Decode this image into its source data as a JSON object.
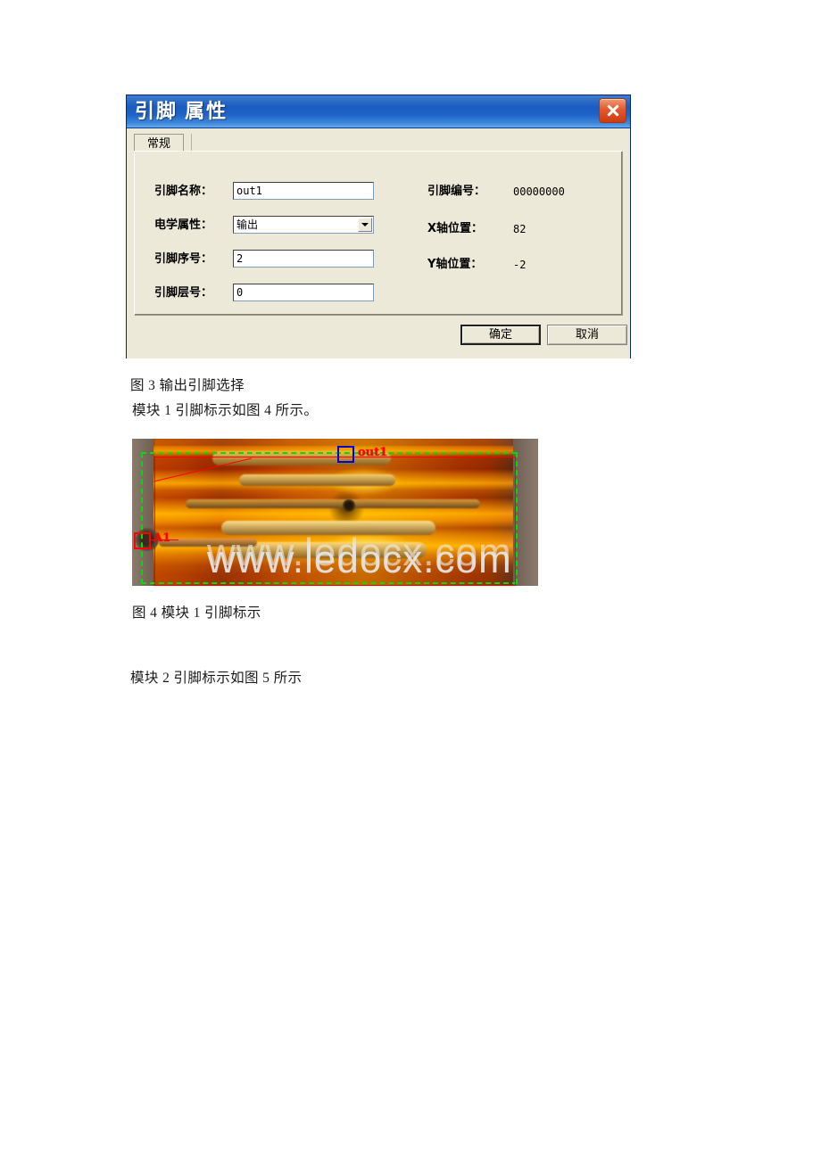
{
  "dialog": {
    "title": "引脚 属性",
    "close_icon": "close-icon",
    "tab": {
      "label": "常规"
    },
    "fields": {
      "pin_name": {
        "label": "引脚名称：",
        "value": "out1"
      },
      "electrical": {
        "label": "电学属性：",
        "value": "输出",
        "arrow_icon": "chevron-down-icon"
      },
      "pin_index": {
        "label": "引脚序号：",
        "value": "2"
      },
      "pin_layer": {
        "label": "引脚层号：",
        "value": "0"
      }
    },
    "readonly": {
      "pin_number": {
        "label": "引脚编号：",
        "value": "00000000"
      },
      "x_position": {
        "label": "X轴位置：",
        "value": "82"
      },
      "y_position": {
        "label": "Y轴位置：",
        "value": "-2"
      }
    },
    "buttons": {
      "ok": "确定",
      "cancel": "取消"
    },
    "colors": {
      "titlebar": "#1a5cc0",
      "face": "#ece9d8",
      "close": "#cf3a10"
    }
  },
  "document": {
    "fig3_caption": "图 3 输出引脚选择",
    "para1": "模块 1 引脚标示如图 4 所示。",
    "fig4_caption": "图 4 模块 1 引脚标示",
    "para2": "模块 2 引脚标示如图 5 所示"
  },
  "figure": {
    "annotations": {
      "out1_label": "out1",
      "a1_label": "A1"
    },
    "watermark": "www.ledocx.com",
    "colors": {
      "boundary_dashed": "#00e000",
      "region_rect": "#ff0000",
      "pin_marker": "#0000cc",
      "origin_marker": "#ff0000"
    }
  }
}
